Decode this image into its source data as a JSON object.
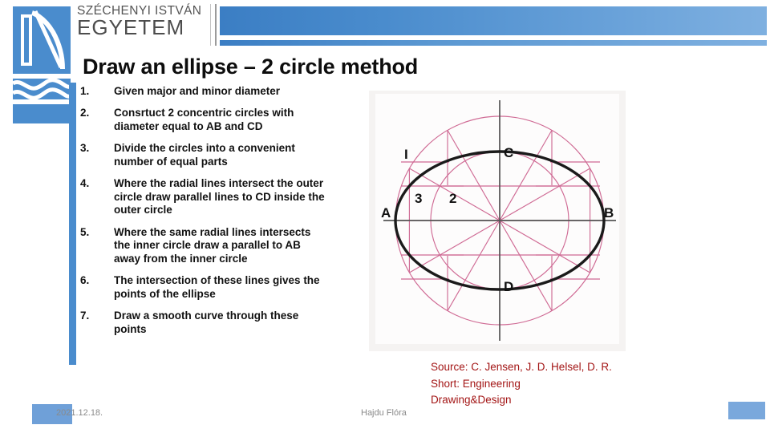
{
  "brand": {
    "line1": "SZÉCHENYI ISTVÁN",
    "line2": "EGYETEM",
    "logo_icon": "szechenyi-bridge-logo",
    "accent_color": "#4a8ccd"
  },
  "title": "Draw an ellipse – 2 circle method",
  "steps": [
    {
      "num": "1.",
      "text": "Given major and minor diameter"
    },
    {
      "num": "2.",
      "text": "Consrtuct 2 concentric circles with diameter equal to AB and CD"
    },
    {
      "num": "3.",
      "text": "Divide the circles into a convenient number of equal parts"
    },
    {
      "num": "4.",
      "text": "Where the radial lines intersect the outer circle draw parallel lines to CD inside the outer circle"
    },
    {
      "num": "5.",
      "text": "Where the same radial lines intersects the inner circle draw a parallel to AB away from the inner circle"
    },
    {
      "num": "6.",
      "text": "The intersection of these lines gives the points of the ellipse"
    },
    {
      "num": "7.",
      "text": "Draw a smooth curve through these points"
    }
  ],
  "diagram": {
    "caption_icon": "ellipse-two-circle-construction",
    "labels": {
      "A": "A",
      "B": "B",
      "C": "C",
      "D": "D",
      "one": "I",
      "two": "2",
      "three": "3"
    },
    "colors": {
      "construction": "#cf6a94",
      "ellipse": "#1a1a1a",
      "axis": "#555555",
      "background": "#f5f3f2"
    }
  },
  "source": {
    "line1": "Source: C. Jensen, J. D. Helsel, D. R.",
    "line2": "Short: Engineering",
    "line3": "Drawing&Design",
    "color": "#a31515"
  },
  "footer": {
    "date": "2021.12.18.",
    "author": "Hajdu Flóra"
  }
}
